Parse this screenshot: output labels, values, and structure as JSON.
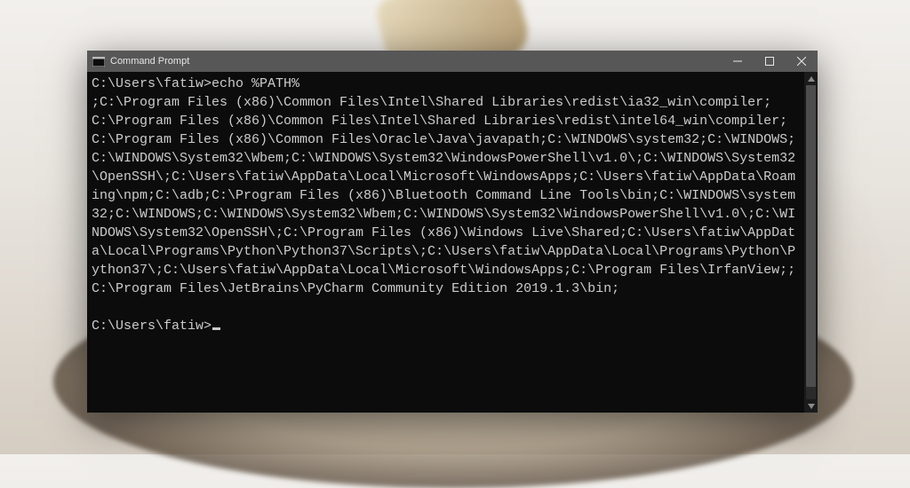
{
  "window": {
    "title": "Command Prompt"
  },
  "terminal": {
    "prompt1": "C:\\Users\\fatiw>",
    "command": "echo %PATH%",
    "output": ";C:\\Program Files (x86)\\Common Files\\Intel\\Shared Libraries\\redist\\ia32_win\\compiler;C:\\Program Files (x86)\\Common Files\\Intel\\Shared Libraries\\redist\\intel64_win\\compiler;C:\\Program Files (x86)\\Common Files\\Oracle\\Java\\javapath;C:\\WINDOWS\\system32;C:\\WINDOWS;C:\\WINDOWS\\System32\\Wbem;C:\\WINDOWS\\System32\\WindowsPowerShell\\v1.0\\;C:\\WINDOWS\\System32\\OpenSSH\\;C:\\Users\\fatiw\\AppData\\Local\\Microsoft\\WindowsApps;C:\\Users\\fatiw\\AppData\\Roaming\\npm;C:\\adb;C:\\Program Files (x86)\\Bluetooth Command Line Tools\\bin;C:\\WINDOWS\\system32;C:\\WINDOWS;C:\\WINDOWS\\System32\\Wbem;C:\\WINDOWS\\System32\\WindowsPowerShell\\v1.0\\;C:\\WINDOWS\\System32\\OpenSSH\\;C:\\Program Files (x86)\\Windows Live\\Shared;C:\\Users\\fatiw\\AppData\\Local\\Programs\\Python\\Python37\\Scripts\\;C:\\Users\\fatiw\\AppData\\Local\\Programs\\Python\\Python37\\;C:\\Users\\fatiw\\AppData\\Local\\Microsoft\\WindowsApps;C:\\Program Files\\IrfanView;;C:\\Program Files\\JetBrains\\PyCharm Community Edition 2019.1.3\\bin;",
    "prompt2": "C:\\Users\\fatiw>"
  }
}
